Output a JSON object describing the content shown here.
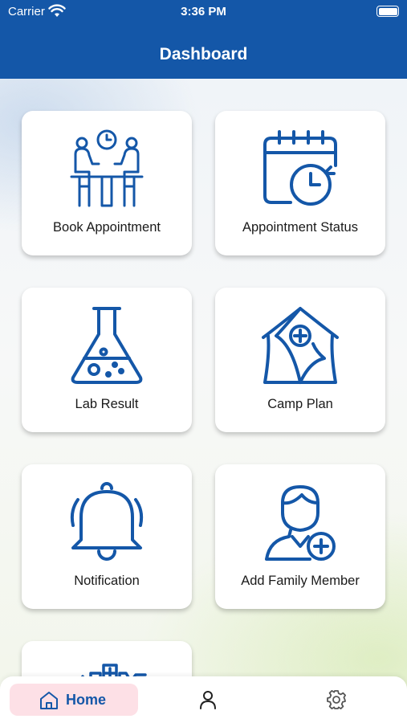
{
  "status_bar": {
    "carrier": "Carrier",
    "time": "3:36 PM"
  },
  "header": {
    "title": "Dashboard"
  },
  "cards": [
    {
      "label": "Book Appointment",
      "icon": "meeting-icon"
    },
    {
      "label": "Appointment Status",
      "icon": "calendar-clock-icon"
    },
    {
      "label": "Lab Result",
      "icon": "flask-icon"
    },
    {
      "label": "Camp Plan",
      "icon": "medical-tent-icon"
    },
    {
      "label": "Notification",
      "icon": "bell-icon"
    },
    {
      "label": "Add Family Member",
      "icon": "add-user-icon"
    },
    {
      "label": "",
      "icon": "health-pulse-icon"
    }
  ],
  "tabbar": {
    "home_label": "Home",
    "tabs": [
      "home-icon",
      "profile-icon",
      "settings-icon"
    ]
  },
  "colors": {
    "primary": "#1457a8",
    "active_tab_bg": "#fde0e6"
  }
}
